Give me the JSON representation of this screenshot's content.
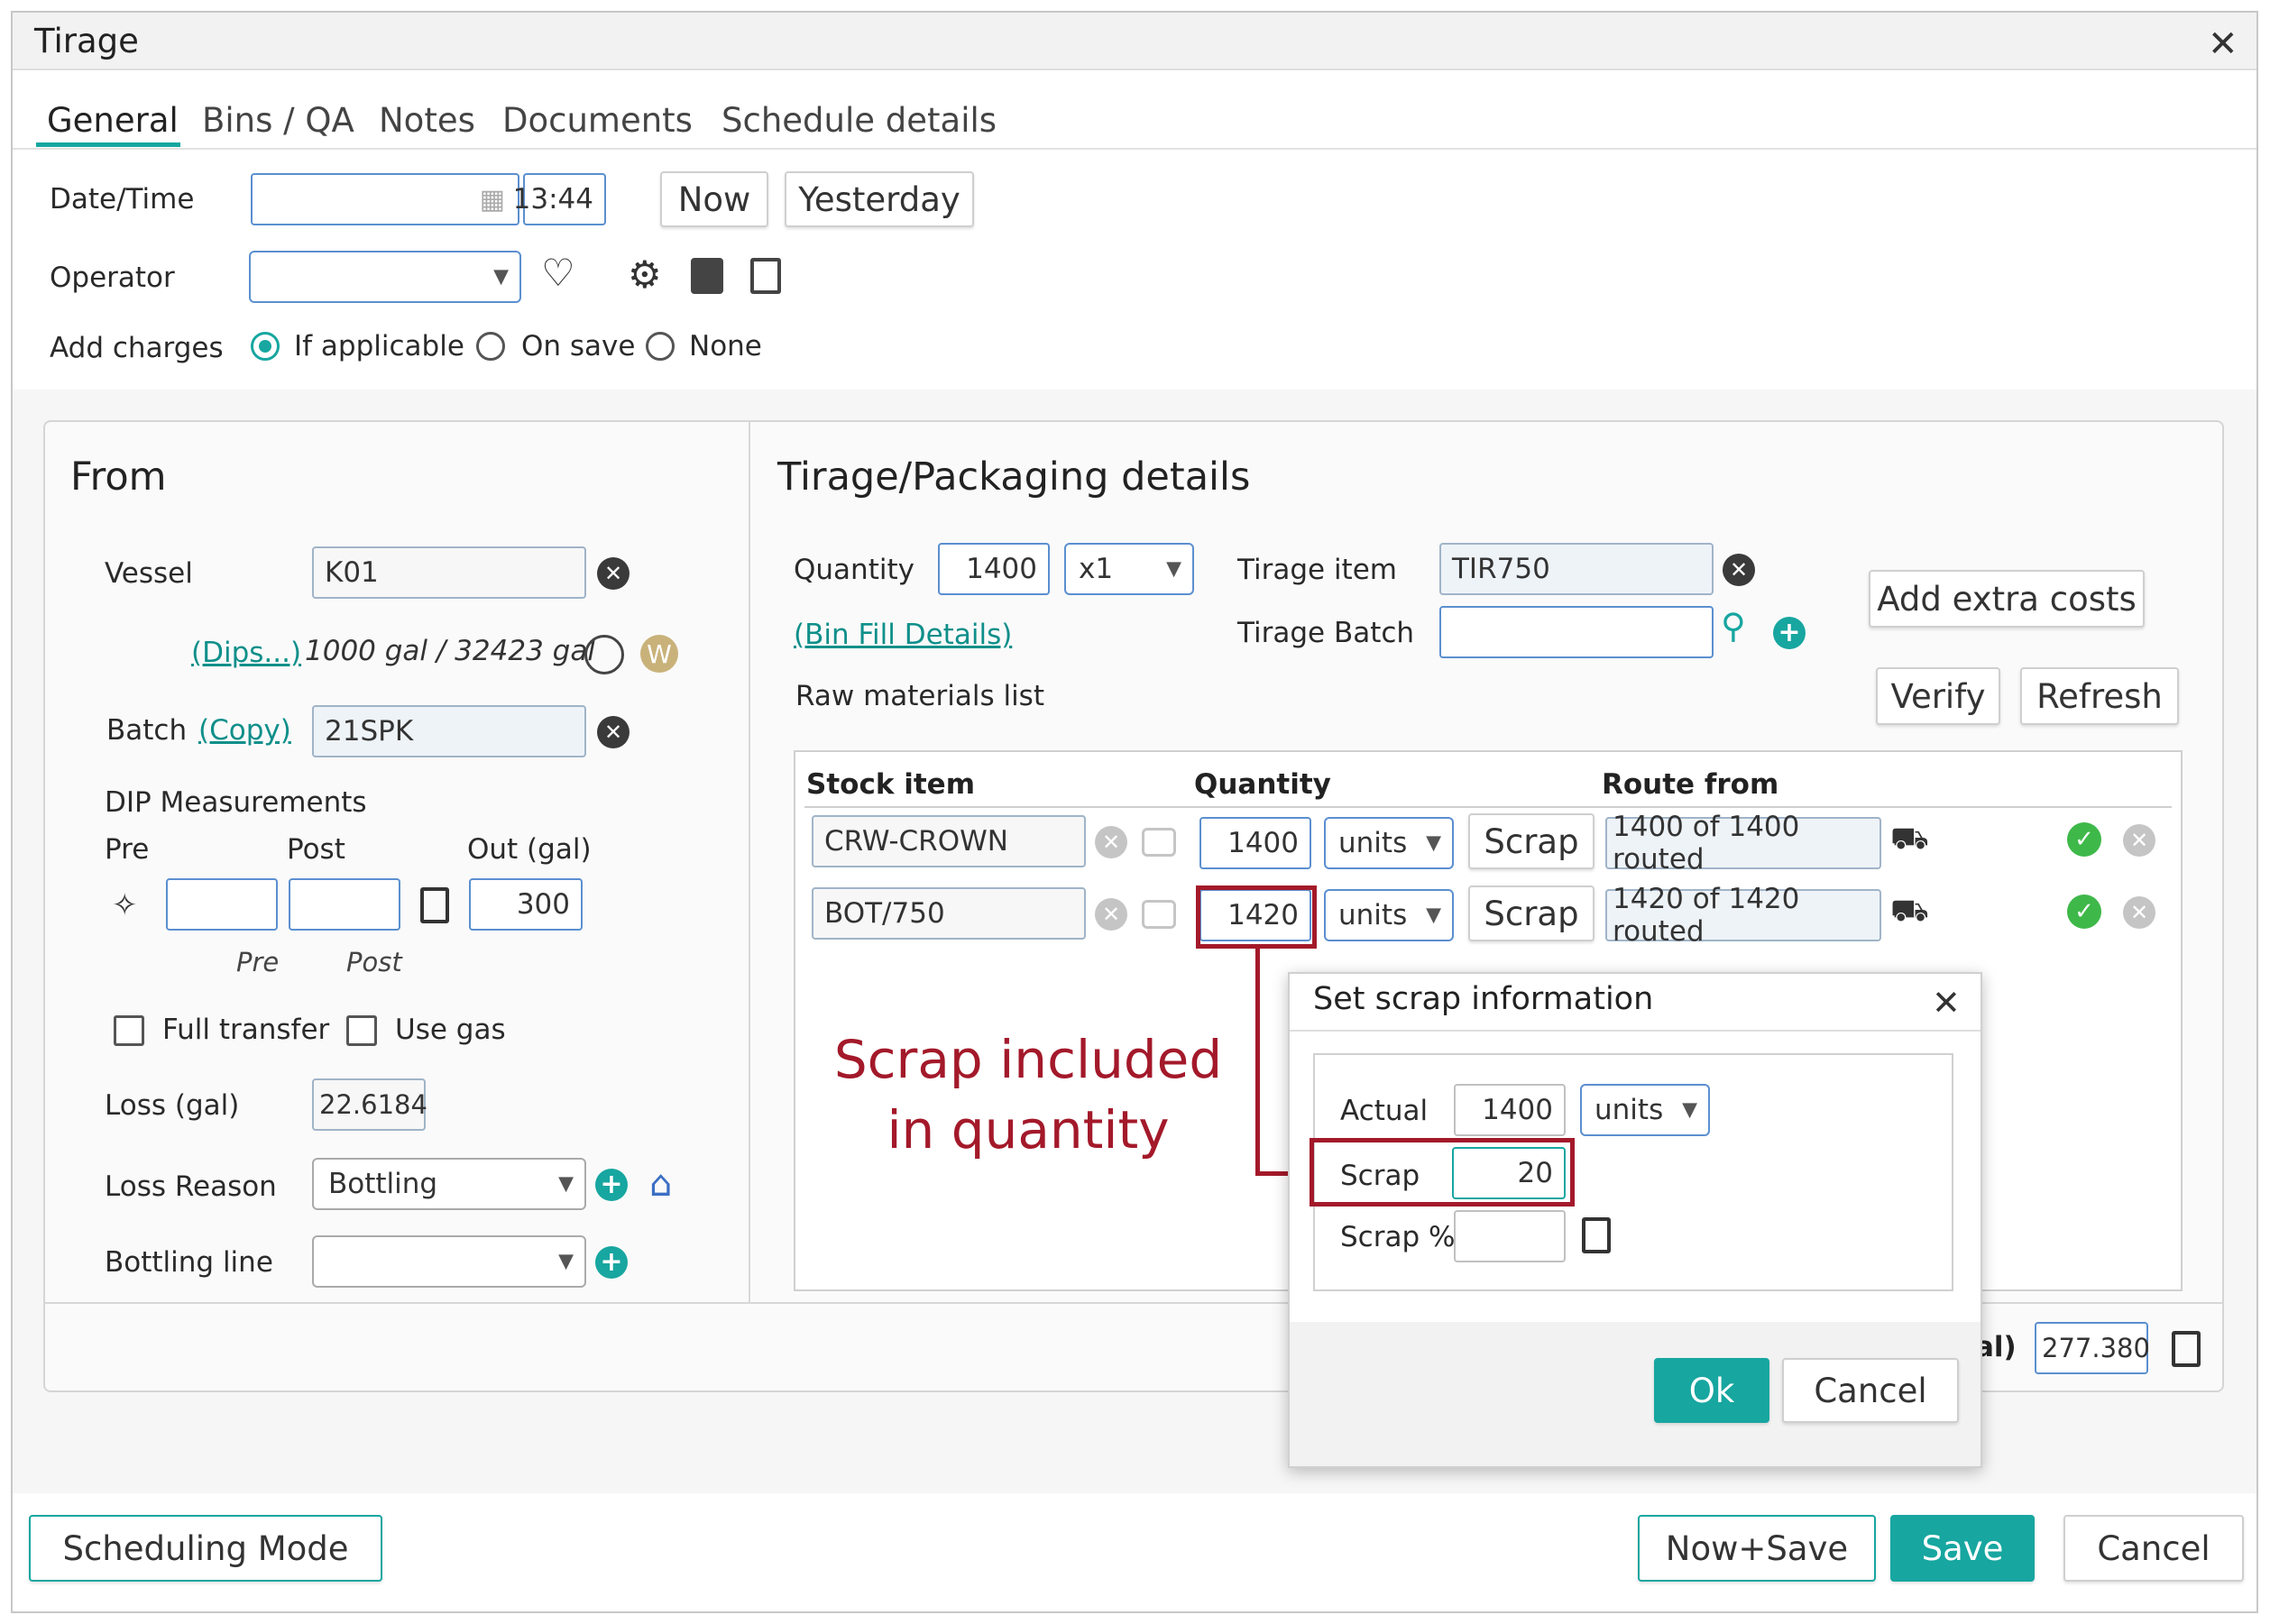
{
  "window": {
    "title": "Tirage"
  },
  "tabs": [
    "General",
    "Bins / QA",
    "Notes",
    "Documents",
    "Schedule details"
  ],
  "general": {
    "datetime_label": "Date/Time",
    "time_value": "13:44",
    "now_label": "Now",
    "yesterday_label": "Yesterday",
    "operator_label": "Operator",
    "add_charges_label": "Add charges",
    "charge_options": [
      "If applicable",
      "On save",
      "None"
    ]
  },
  "from": {
    "title": "From",
    "vessel_label": "Vessel",
    "vessel_value": "K01",
    "dips_link": "(Dips...)",
    "volume_text": "1000 gal / 32423 gal",
    "w_badge": "W",
    "batch_label": "Batch",
    "copy_link": "(Copy)",
    "batch_value": "21SPK",
    "dip_title": "DIP Measurements",
    "pre_label": "Pre",
    "post_label": "Post",
    "out_label": "Out (gal)",
    "out_value": "300",
    "pre_sub": "Pre",
    "post_sub": "Post",
    "full_transfer_label": "Full transfer",
    "use_gas_label": "Use gas",
    "loss_label": "Loss (gal)",
    "loss_value": "22.6184",
    "loss_reason_label": "Loss Reason",
    "loss_reason_value": "Bottling",
    "bottling_line_label": "Bottling line"
  },
  "tirage": {
    "title": "Tirage/Packaging details",
    "quantity_label": "Quantity",
    "quantity_value": "1400",
    "multiplier": "x1",
    "bin_fill_link": "(Bin Fill Details)",
    "tirage_item_label": "Tirage item",
    "tirage_item_value": "TIR750",
    "tirage_batch_label": "Tirage Batch",
    "add_extra_costs_label": "Add extra costs",
    "raw_materials_label": "Raw materials list",
    "verify_label": "Verify",
    "refresh_label": "Refresh",
    "columns": [
      "Stock item",
      "Quantity",
      "Route from"
    ],
    "rows": [
      {
        "stock": "CRW-CROWN",
        "qty": "1400",
        "unit": "units",
        "scrap_label": "Scrap",
        "route": "1400 of 1400 routed"
      },
      {
        "stock": "BOT/750",
        "qty": "1420",
        "unit": "units",
        "scrap_label": "Scrap",
        "route": "1420 of 1420 routed"
      }
    ],
    "total_label_partial": "al)",
    "total_value": "277.380"
  },
  "scrap_dialog": {
    "title": "Set scrap information",
    "actual_label": "Actual",
    "actual_value": "1400",
    "actual_unit": "units",
    "scrap_label": "Scrap",
    "scrap_value": "20",
    "scrap_pct_label": "Scrap %",
    "ok_label": "Ok",
    "cancel_label": "Cancel"
  },
  "annotation": {
    "line1": "Scrap included",
    "line2": "in quantity",
    "color": "#a3192a"
  },
  "footer": {
    "scheduling_mode_label": "Scheduling Mode",
    "now_save_label": "Now+Save",
    "save_label": "Save",
    "cancel_label": "Cancel"
  },
  "colors": {
    "accent": "#17a6a0",
    "field_border": "#5b8fd0",
    "annotation": "#a3192a",
    "ok_green": "#3fb84a"
  }
}
